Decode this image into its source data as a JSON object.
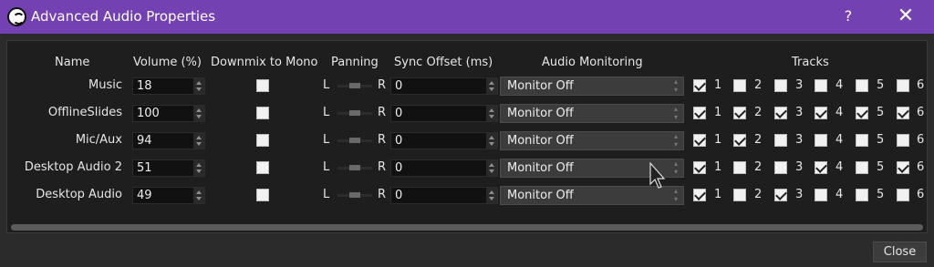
{
  "window": {
    "title": "Advanced Audio Properties",
    "help_label": "?",
    "close_glyph": "✕"
  },
  "headers": {
    "name": "Name",
    "volume": "Volume (%)",
    "downmix": "Downmix to Mono",
    "panning": "Panning",
    "sync": "Sync Offset (ms)",
    "monitoring": "Audio Monitoring",
    "tracks": "Tracks"
  },
  "pan_labels": {
    "left": "L",
    "right": "R"
  },
  "track_numbers": [
    "1",
    "2",
    "3",
    "4",
    "5",
    "6"
  ],
  "rows": [
    {
      "name": "Music",
      "volume": "18",
      "mono": false,
      "pan_position": 0.5,
      "sync": "0",
      "monitoring": "Monitor Off",
      "tracks": [
        true,
        false,
        false,
        false,
        false,
        false
      ]
    },
    {
      "name": "OfflineSlides",
      "volume": "100",
      "mono": false,
      "pan_position": 0.5,
      "sync": "0",
      "monitoring": "Monitor Off",
      "tracks": [
        true,
        true,
        true,
        true,
        true,
        true
      ]
    },
    {
      "name": "Mic/Aux",
      "volume": "94",
      "mono": false,
      "pan_position": 0.5,
      "sync": "0",
      "monitoring": "Monitor Off",
      "tracks": [
        true,
        true,
        false,
        false,
        false,
        false
      ]
    },
    {
      "name": "Desktop Audio 2",
      "volume": "51",
      "mono": false,
      "pan_position": 0.5,
      "sync": "0",
      "monitoring": "Monitor Off",
      "tracks": [
        true,
        false,
        false,
        true,
        false,
        true
      ]
    },
    {
      "name": "Desktop Audio",
      "volume": "49",
      "mono": false,
      "pan_position": 0.5,
      "sync": "0",
      "monitoring": "Monitor Off",
      "tracks": [
        true,
        false,
        true,
        false,
        false,
        false
      ]
    }
  ],
  "footer": {
    "close_label": "Close"
  },
  "colors": {
    "titlebar": "#7341b2",
    "background": "#2b2b2b",
    "panel": "#1e1e1e"
  }
}
